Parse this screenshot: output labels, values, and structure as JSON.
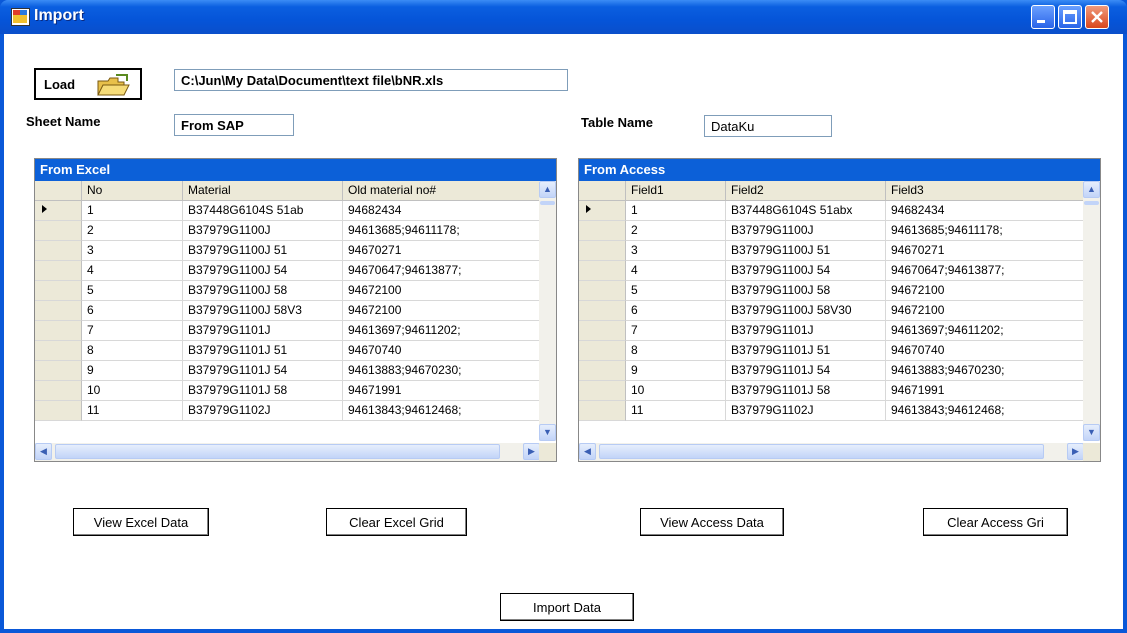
{
  "window": {
    "title": "Import"
  },
  "load": {
    "label": "Load",
    "path": "C:\\Jun\\My Data\\Document\\text file\\bNR.xls"
  },
  "sheet": {
    "label": "Sheet Name",
    "value": "From SAP"
  },
  "table": {
    "label": "Table Name",
    "value": "DataKu"
  },
  "excel_grid": {
    "caption": "From Excel",
    "columns": [
      "No",
      "Material",
      "Old material no#"
    ],
    "rows": [
      [
        "1",
        "B37448G6104S 51ab",
        "94682434"
      ],
      [
        "2",
        "B37979G1100J",
        "94613685;94611178;"
      ],
      [
        "3",
        "B37979G1100J 51",
        "94670271"
      ],
      [
        "4",
        "B37979G1100J 54",
        "94670647;94613877;"
      ],
      [
        "5",
        "B37979G1100J 58",
        "94672100"
      ],
      [
        "6",
        "B37979G1100J 58V3",
        "94672100"
      ],
      [
        "7",
        "B37979G1101J",
        "94613697;94611202;"
      ],
      [
        "8",
        "B37979G1101J 51",
        "94670740"
      ],
      [
        "9",
        "B37979G1101J 54",
        "94613883;94670230;"
      ],
      [
        "10",
        "B37979G1101J 58",
        "94671991"
      ],
      [
        "11",
        "B37979G1102J",
        "94613843;94612468;"
      ]
    ]
  },
  "access_grid": {
    "caption": "From Access",
    "columns": [
      "Field1",
      "Field2",
      "Field3"
    ],
    "rows": [
      [
        "1",
        "B37448G6104S 51abx",
        "94682434"
      ],
      [
        "2",
        "B37979G1100J",
        "94613685;94611178;"
      ],
      [
        "3",
        "B37979G1100J 51",
        "94670271"
      ],
      [
        "4",
        "B37979G1100J 54",
        "94670647;94613877;"
      ],
      [
        "5",
        "B37979G1100J 58",
        "94672100"
      ],
      [
        "6",
        "B37979G1100J 58V30",
        "94672100"
      ],
      [
        "7",
        "B37979G1101J",
        "94613697;94611202;"
      ],
      [
        "8",
        "B37979G1101J 51",
        "94670740"
      ],
      [
        "9",
        "B37979G1101J 54",
        "94613883;94670230;"
      ],
      [
        "10",
        "B37979G1101J 58",
        "94671991"
      ],
      [
        "11",
        "B37979G1102J",
        "94613843;94612468;"
      ]
    ]
  },
  "buttons": {
    "view_excel": "View Excel Data",
    "clear_excel": "Clear Excel Grid",
    "view_access": "View Access Data",
    "clear_access": "Clear Access Gri",
    "import": "Import Data"
  },
  "icons": {
    "row_pointer": "current-row-arrow-icon",
    "open_folder": "open-folder-icon"
  },
  "colors": {
    "titlebar": "#0554d8",
    "grid_caption": "#0c60d8",
    "header_bg": "#ece9d8"
  }
}
